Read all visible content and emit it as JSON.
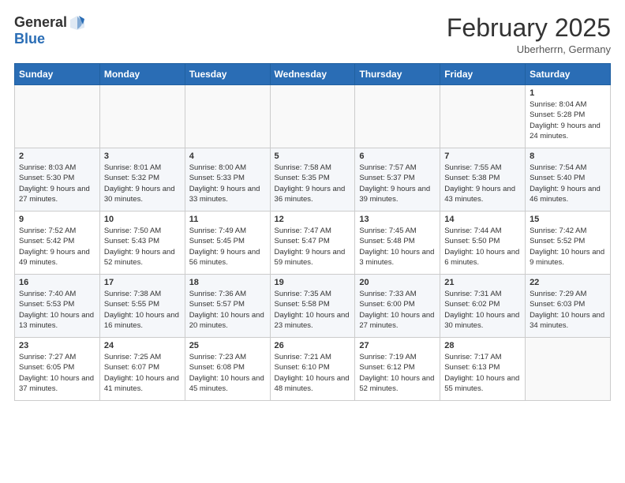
{
  "header": {
    "logo_general": "General",
    "logo_blue": "Blue",
    "month": "February 2025",
    "location": "Uberherrn, Germany"
  },
  "weekdays": [
    "Sunday",
    "Monday",
    "Tuesday",
    "Wednesday",
    "Thursday",
    "Friday",
    "Saturday"
  ],
  "weeks": [
    [
      {
        "day": "",
        "info": ""
      },
      {
        "day": "",
        "info": ""
      },
      {
        "day": "",
        "info": ""
      },
      {
        "day": "",
        "info": ""
      },
      {
        "day": "",
        "info": ""
      },
      {
        "day": "",
        "info": ""
      },
      {
        "day": "1",
        "info": "Sunrise: 8:04 AM\nSunset: 5:28 PM\nDaylight: 9 hours and 24 minutes."
      }
    ],
    [
      {
        "day": "2",
        "info": "Sunrise: 8:03 AM\nSunset: 5:30 PM\nDaylight: 9 hours and 27 minutes."
      },
      {
        "day": "3",
        "info": "Sunrise: 8:01 AM\nSunset: 5:32 PM\nDaylight: 9 hours and 30 minutes."
      },
      {
        "day": "4",
        "info": "Sunrise: 8:00 AM\nSunset: 5:33 PM\nDaylight: 9 hours and 33 minutes."
      },
      {
        "day": "5",
        "info": "Sunrise: 7:58 AM\nSunset: 5:35 PM\nDaylight: 9 hours and 36 minutes."
      },
      {
        "day": "6",
        "info": "Sunrise: 7:57 AM\nSunset: 5:37 PM\nDaylight: 9 hours and 39 minutes."
      },
      {
        "day": "7",
        "info": "Sunrise: 7:55 AM\nSunset: 5:38 PM\nDaylight: 9 hours and 43 minutes."
      },
      {
        "day": "8",
        "info": "Sunrise: 7:54 AM\nSunset: 5:40 PM\nDaylight: 9 hours and 46 minutes."
      }
    ],
    [
      {
        "day": "9",
        "info": "Sunrise: 7:52 AM\nSunset: 5:42 PM\nDaylight: 9 hours and 49 minutes."
      },
      {
        "day": "10",
        "info": "Sunrise: 7:50 AM\nSunset: 5:43 PM\nDaylight: 9 hours and 52 minutes."
      },
      {
        "day": "11",
        "info": "Sunrise: 7:49 AM\nSunset: 5:45 PM\nDaylight: 9 hours and 56 minutes."
      },
      {
        "day": "12",
        "info": "Sunrise: 7:47 AM\nSunset: 5:47 PM\nDaylight: 9 hours and 59 minutes."
      },
      {
        "day": "13",
        "info": "Sunrise: 7:45 AM\nSunset: 5:48 PM\nDaylight: 10 hours and 3 minutes."
      },
      {
        "day": "14",
        "info": "Sunrise: 7:44 AM\nSunset: 5:50 PM\nDaylight: 10 hours and 6 minutes."
      },
      {
        "day": "15",
        "info": "Sunrise: 7:42 AM\nSunset: 5:52 PM\nDaylight: 10 hours and 9 minutes."
      }
    ],
    [
      {
        "day": "16",
        "info": "Sunrise: 7:40 AM\nSunset: 5:53 PM\nDaylight: 10 hours and 13 minutes."
      },
      {
        "day": "17",
        "info": "Sunrise: 7:38 AM\nSunset: 5:55 PM\nDaylight: 10 hours and 16 minutes."
      },
      {
        "day": "18",
        "info": "Sunrise: 7:36 AM\nSunset: 5:57 PM\nDaylight: 10 hours and 20 minutes."
      },
      {
        "day": "19",
        "info": "Sunrise: 7:35 AM\nSunset: 5:58 PM\nDaylight: 10 hours and 23 minutes."
      },
      {
        "day": "20",
        "info": "Sunrise: 7:33 AM\nSunset: 6:00 PM\nDaylight: 10 hours and 27 minutes."
      },
      {
        "day": "21",
        "info": "Sunrise: 7:31 AM\nSunset: 6:02 PM\nDaylight: 10 hours and 30 minutes."
      },
      {
        "day": "22",
        "info": "Sunrise: 7:29 AM\nSunset: 6:03 PM\nDaylight: 10 hours and 34 minutes."
      }
    ],
    [
      {
        "day": "23",
        "info": "Sunrise: 7:27 AM\nSunset: 6:05 PM\nDaylight: 10 hours and 37 minutes."
      },
      {
        "day": "24",
        "info": "Sunrise: 7:25 AM\nSunset: 6:07 PM\nDaylight: 10 hours and 41 minutes."
      },
      {
        "day": "25",
        "info": "Sunrise: 7:23 AM\nSunset: 6:08 PM\nDaylight: 10 hours and 45 minutes."
      },
      {
        "day": "26",
        "info": "Sunrise: 7:21 AM\nSunset: 6:10 PM\nDaylight: 10 hours and 48 minutes."
      },
      {
        "day": "27",
        "info": "Sunrise: 7:19 AM\nSunset: 6:12 PM\nDaylight: 10 hours and 52 minutes."
      },
      {
        "day": "28",
        "info": "Sunrise: 7:17 AM\nSunset: 6:13 PM\nDaylight: 10 hours and 55 minutes."
      },
      {
        "day": "",
        "info": ""
      }
    ]
  ]
}
